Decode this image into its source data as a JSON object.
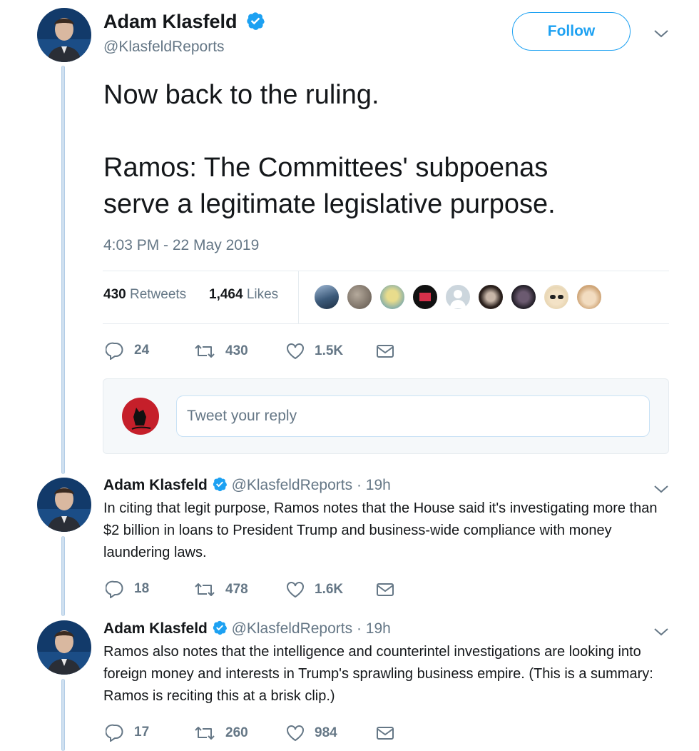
{
  "main_tweet": {
    "author_name": "Adam Klasfeld",
    "author_handle": "@KlasfeldReports",
    "follow_label": "Follow",
    "text_line1": "Now back to the ruling.",
    "text_line2": "Ramos: The Committees' subpoenas",
    "text_line3": "serve a legitimate legislative purpose.",
    "timestamp": "4:03 PM - 22 May 2019",
    "retweets_count": "430",
    "retweets_label": "Retweets",
    "likes_count": "1,464",
    "likes_label": "Likes",
    "actions": {
      "replies": "24",
      "retweets": "430",
      "likes": "1.5K"
    }
  },
  "reply_box": {
    "placeholder": "Tweet your reply"
  },
  "replies": [
    {
      "author_name": "Adam Klasfeld",
      "author_handle": "@KlasfeldReports",
      "time": "· 19h",
      "text": "In citing that legit purpose, Ramos notes that the House said it's investigating more than $2 billion in loans to President Trump and business-wide compliance with money laundering laws.",
      "actions": {
        "replies": "18",
        "retweets": "478",
        "likes": "1.6K"
      }
    },
    {
      "author_name": "Adam Klasfeld",
      "author_handle": "@KlasfeldReports",
      "time": "· 19h",
      "text": "Ramos also notes that the intelligence and counterintel investigations are looking into foreign money and interests in Trump's sprawling business empire. (This is a summary: Ramos is reciting this at a brisk clip.)",
      "actions": {
        "replies": "17",
        "retweets": "260",
        "likes": "984"
      }
    }
  ],
  "colors": {
    "accent": "#1da1f2",
    "muted": "#657786",
    "text": "#14171a",
    "thread_line": "#cfe0f0"
  }
}
